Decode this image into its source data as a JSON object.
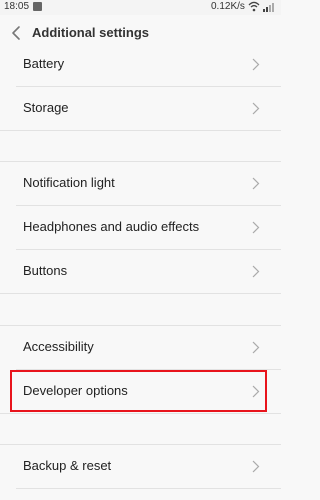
{
  "status_bar": {
    "time": "18:05",
    "speed": "0.12K/s",
    "icons": [
      "notification-icon",
      "wifi-icon",
      "signal-icon"
    ]
  },
  "header": {
    "title": "Additional settings",
    "back_icon": "chevron-left-icon"
  },
  "groups": [
    {
      "items": [
        {
          "label": "Battery"
        },
        {
          "label": "Storage"
        }
      ]
    },
    {
      "items": [
        {
          "label": "Notification light"
        },
        {
          "label": "Headphones and audio effects"
        },
        {
          "label": "Buttons"
        }
      ]
    },
    {
      "items": [
        {
          "label": "Accessibility"
        },
        {
          "label": "Developer options",
          "highlighted": true
        }
      ]
    },
    {
      "items": [
        {
          "label": "Backup & reset"
        }
      ]
    }
  ],
  "colors": {
    "highlight_border": "#e8141c",
    "background": "#f8f8f8",
    "separator": "#e2e2e2"
  }
}
